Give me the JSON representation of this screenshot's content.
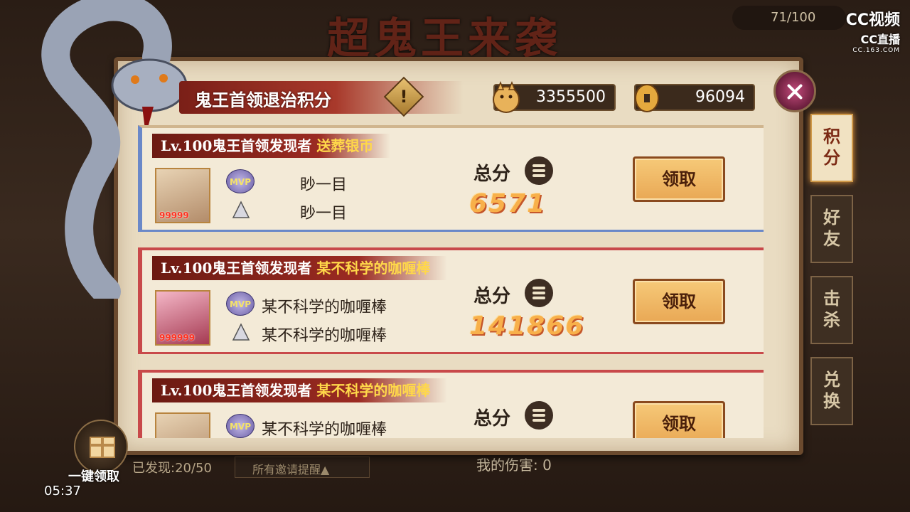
{
  "background": {
    "title": "超鬼王来袭",
    "top_counter": "71/100",
    "found": "已发现:20/50",
    "invite_button": "所有邀请提醒▲",
    "damage_text": "我的伤害: 0",
    "timestamp": "05:37"
  },
  "watermark": {
    "line1": "CC视频",
    "line2": "CC直播",
    "line3": "CC.163.COM"
  },
  "bottom_action": {
    "label": "一键领取"
  },
  "panel": {
    "title": "鬼王首领退治积分",
    "info_label": "!",
    "currency_1": "3355500",
    "currency_2": "96094"
  },
  "tabs": [
    {
      "label": "积分",
      "active": true
    },
    {
      "label": "好友",
      "active": false
    },
    {
      "label": "击杀",
      "active": false
    },
    {
      "label": "兑换",
      "active": false
    }
  ],
  "entries": [
    {
      "header_prefix": "Lv.100鬼王首领发现者",
      "discoverer": "送葬银币",
      "avatar_level": "99999",
      "mvp_label": "MVP",
      "mvp_name": "眇一目",
      "second_name": "眇一目",
      "score_label": "总分",
      "score": "6571",
      "claim_label": "领取"
    },
    {
      "header_prefix": "Lv.100鬼王首领发现者",
      "discoverer": "某不科学的咖喱棒",
      "avatar_level": "999999",
      "mvp_label": "MVP",
      "mvp_name": "某不科学的咖喱棒",
      "second_name": "某不科学的咖喱棒",
      "score_label": "总分",
      "score": "141866",
      "claim_label": "领取"
    },
    {
      "header_prefix": "Lv.100鬼王首领发现者",
      "discoverer": "某不科学的咖喱棒",
      "avatar_level": "",
      "mvp_label": "MVP",
      "mvp_name": "某不科学的咖喱棒",
      "second_name": "",
      "score_label": "总分",
      "score": "",
      "claim_label": "领取"
    }
  ],
  "colors": {
    "panel_bg": "#e9dcc2",
    "header_red": "#9b2b22",
    "highlight_yellow": "#ffd84a",
    "score_orange": "#f8b04a",
    "claim_button": "#f6c978",
    "first_entry_border": "#6a88c8",
    "other_entry_border": "#c8494a"
  }
}
